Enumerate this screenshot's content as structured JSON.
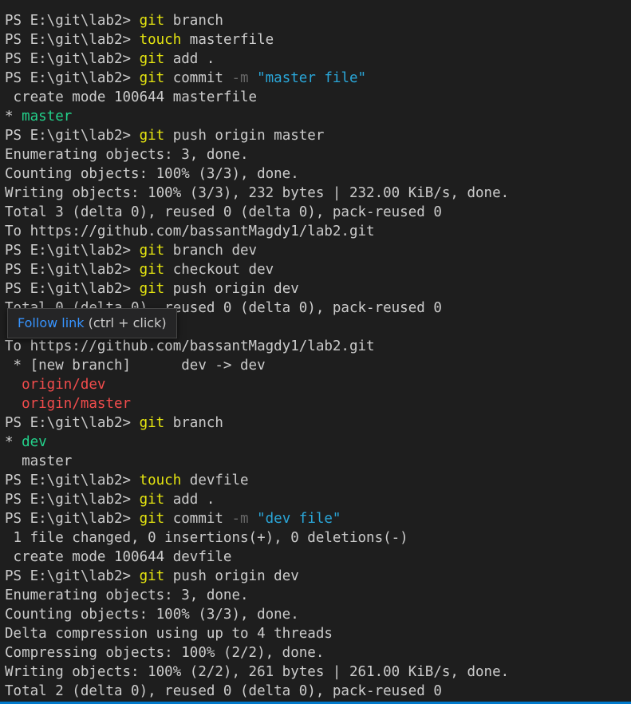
{
  "prompt": "PS E:\\git\\lab2> ",
  "lines": [
    {
      "parts": [
        {
          "t": "prompt"
        },
        {
          "t": "cmd",
          "v": "git"
        },
        {
          "t": "txt",
          "v": " branch"
        }
      ]
    },
    {
      "parts": [
        {
          "t": "prompt"
        },
        {
          "t": "cmd",
          "v": "touch"
        },
        {
          "t": "txt",
          "v": " masterfile"
        }
      ]
    },
    {
      "parts": [
        {
          "t": "prompt"
        },
        {
          "t": "cmd",
          "v": "git"
        },
        {
          "t": "txt",
          "v": " add ."
        }
      ]
    },
    {
      "parts": [
        {
          "t": "prompt"
        },
        {
          "t": "cmd",
          "v": "git"
        },
        {
          "t": "txt",
          "v": " commit "
        },
        {
          "t": "flag",
          "v": "-m"
        },
        {
          "t": "txt",
          "v": " "
        },
        {
          "t": "str",
          "v": "\"master file\""
        }
      ]
    },
    {
      "parts": [
        {
          "t": "txt",
          "v": " create mode 100644 masterfile"
        }
      ]
    },
    {
      "parts": [
        {
          "t": "txt",
          "v": "* "
        },
        {
          "t": "green",
          "v": "master"
        }
      ]
    },
    {
      "parts": [
        {
          "t": "prompt"
        },
        {
          "t": "cmd",
          "v": "git"
        },
        {
          "t": "txt",
          "v": " push origin master"
        }
      ]
    },
    {
      "parts": [
        {
          "t": "txt",
          "v": "Enumerating objects: 3, done."
        }
      ]
    },
    {
      "parts": [
        {
          "t": "txt",
          "v": "Counting objects: 100% (3/3), done."
        }
      ]
    },
    {
      "parts": [
        {
          "t": "txt",
          "v": "Writing objects: 100% (3/3), 232 bytes | 232.00 KiB/s, done."
        }
      ]
    },
    {
      "parts": [
        {
          "t": "txt",
          "v": "Total 3 (delta 0), reused 0 (delta 0), pack-reused 0"
        }
      ]
    },
    {
      "parts": [
        {
          "t": "txt",
          "v": "To https://github.com/bassantMagdy1/lab2.git"
        }
      ]
    },
    {
      "parts": [
        {
          "t": "prompt"
        },
        {
          "t": "cmd",
          "v": "git"
        },
        {
          "t": "txt",
          "v": " branch dev"
        }
      ]
    },
    {
      "parts": [
        {
          "t": "prompt"
        },
        {
          "t": "cmd",
          "v": "git"
        },
        {
          "t": "txt",
          "v": " checkout dev"
        }
      ]
    },
    {
      "parts": [
        {
          "t": "prompt"
        },
        {
          "t": "cmd",
          "v": "git"
        },
        {
          "t": "txt",
          "v": " push origin dev"
        }
      ]
    },
    {
      "parts": [
        {
          "t": "txt",
          "v": "Total 0 (delta 0), reused 0 (delta 0), pack-reused 0"
        }
      ]
    },
    {
      "parts": [
        {
          "t": "txt",
          "v": ""
        }
      ]
    },
    {
      "parts": [
        {
          "t": "txt",
          "v": "To https://github.com/bassantMagdy1/lab2.git"
        }
      ]
    },
    {
      "parts": [
        {
          "t": "txt",
          "v": " * [new branch]      dev -> dev"
        }
      ]
    },
    {
      "parts": [
        {
          "t": "txt",
          "v": "  "
        },
        {
          "t": "red",
          "v": "origin/dev"
        }
      ]
    },
    {
      "parts": [
        {
          "t": "txt",
          "v": "  "
        },
        {
          "t": "red",
          "v": "origin/master"
        }
      ]
    },
    {
      "parts": [
        {
          "t": "prompt"
        },
        {
          "t": "cmd",
          "v": "git"
        },
        {
          "t": "txt",
          "v": " branch"
        }
      ]
    },
    {
      "parts": [
        {
          "t": "txt",
          "v": "* "
        },
        {
          "t": "green",
          "v": "dev"
        }
      ]
    },
    {
      "parts": [
        {
          "t": "txt",
          "v": "  master"
        }
      ]
    },
    {
      "parts": [
        {
          "t": "prompt"
        },
        {
          "t": "cmd",
          "v": "touch"
        },
        {
          "t": "txt",
          "v": " devfile"
        }
      ]
    },
    {
      "parts": [
        {
          "t": "prompt"
        },
        {
          "t": "cmd",
          "v": "git"
        },
        {
          "t": "txt",
          "v": " add ."
        }
      ]
    },
    {
      "parts": [
        {
          "t": "prompt"
        },
        {
          "t": "cmd",
          "v": "git"
        },
        {
          "t": "txt",
          "v": " commit "
        },
        {
          "t": "flag",
          "v": "-m"
        },
        {
          "t": "txt",
          "v": " "
        },
        {
          "t": "str",
          "v": "\"dev file\""
        }
      ]
    },
    {
      "parts": [
        {
          "t": "txt",
          "v": " 1 file changed, 0 insertions(+), 0 deletions(-)"
        }
      ]
    },
    {
      "parts": [
        {
          "t": "txt",
          "v": " create mode 100644 devfile"
        }
      ]
    },
    {
      "parts": [
        {
          "t": "prompt"
        },
        {
          "t": "cmd",
          "v": "git"
        },
        {
          "t": "txt",
          "v": " push origin dev"
        }
      ]
    },
    {
      "parts": [
        {
          "t": "txt",
          "v": "Enumerating objects: 3, done."
        }
      ]
    },
    {
      "parts": [
        {
          "t": "txt",
          "v": "Counting objects: 100% (3/3), done."
        }
      ]
    },
    {
      "parts": [
        {
          "t": "txt",
          "v": "Delta compression using up to 4 threads"
        }
      ]
    },
    {
      "parts": [
        {
          "t": "txt",
          "v": "Compressing objects: 100% (2/2), done."
        }
      ]
    },
    {
      "parts": [
        {
          "t": "txt",
          "v": "Writing objects: 100% (2/2), 261 bytes | 261.00 KiB/s, done."
        }
      ]
    },
    {
      "parts": [
        {
          "t": "txt",
          "v": "Total 2 (delta 0), reused 0 (delta 0), pack-reused 0"
        }
      ]
    }
  ],
  "tooltip": {
    "link_label": "Follow link",
    "hint": " (ctrl + click)"
  }
}
